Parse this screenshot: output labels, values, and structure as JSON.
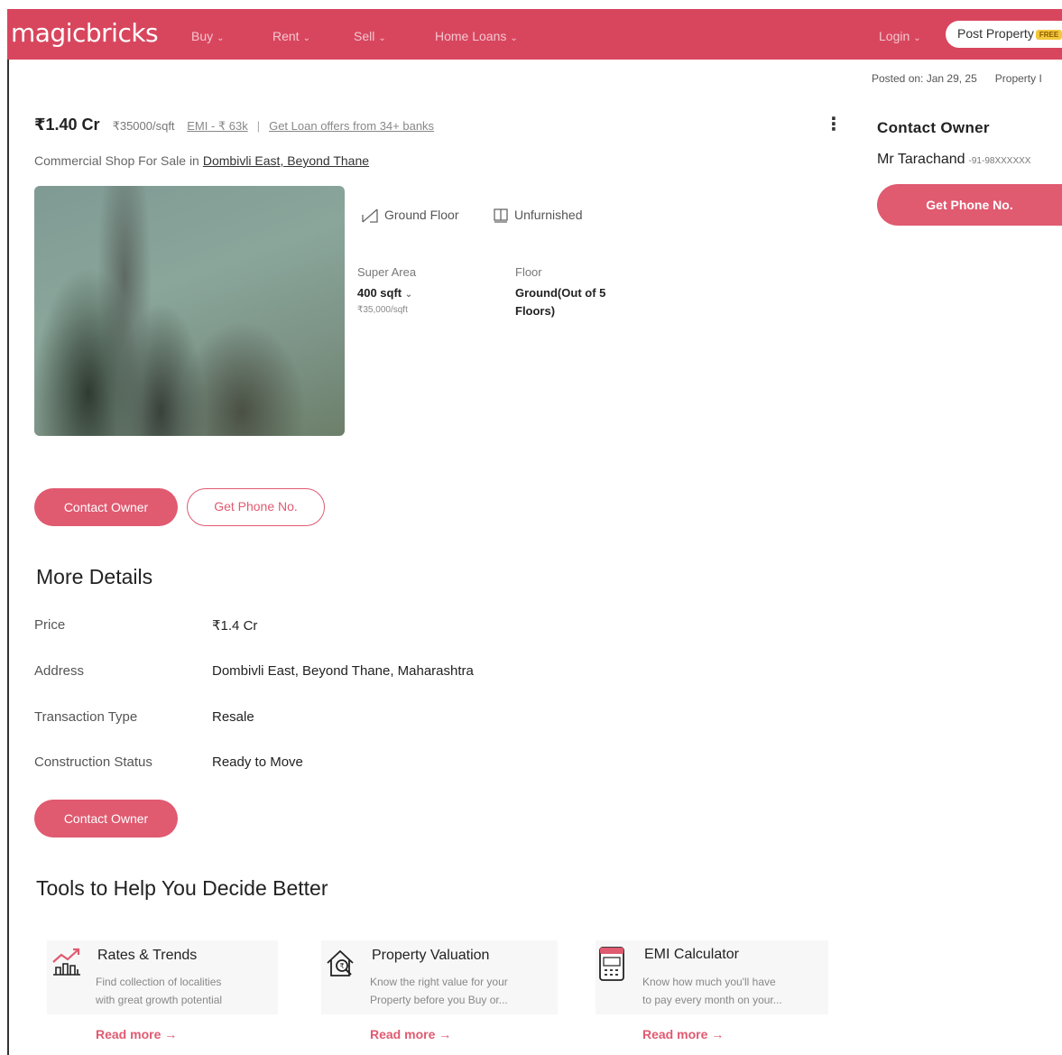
{
  "header": {
    "logo": "magicbricks",
    "nav": [
      {
        "label": "Buy"
      },
      {
        "label": "Rent"
      },
      {
        "label": "Sell"
      },
      {
        "label": "Home Loans"
      },
      {
        "label": "Login"
      }
    ],
    "post_property": "Post Property",
    "free_badge": "FREE",
    "brand_color": "#d8465e"
  },
  "meta": {
    "posted_on": "Posted on: Jan 29, 25",
    "property_id": "Property I"
  },
  "listing": {
    "price": "₹1.40 Cr",
    "price_per_sqft": "₹35000/sqft",
    "emi": "EMI - ₹ 63k",
    "loan_offers": "Get Loan offers from 34+ banks",
    "subtitle": "Commercial Shop For Sale in",
    "location": "Dombivli East, Beyond Thane",
    "chips": [
      {
        "icon": "floor-icon",
        "label": "Ground Floor"
      },
      {
        "icon": "furnishing-icon",
        "label": "Unfurnished"
      }
    ],
    "super_area_label": "Super Area",
    "super_area_value": "400 sqft",
    "super_area_rate": "₹35,000/sqft",
    "floor_label": "Floor",
    "floor_value_line1": "Ground(Out of 5",
    "floor_value_line2": "Floors)",
    "contact_owner": "Contact Owner",
    "get_phone": "Get Phone No."
  },
  "more_details": {
    "title": "More Details",
    "rows": [
      {
        "label": "Price",
        "value": "₹1.4 Cr"
      },
      {
        "label": "Address",
        "value": "Dombivli East, Beyond Thane, Maharashtra"
      },
      {
        "label": "Transaction Type",
        "value": "Resale"
      },
      {
        "label": "Construction Status",
        "value": "Ready to Move"
      }
    ],
    "contact_owner": "Contact Owner"
  },
  "sidebar": {
    "title": "Contact Owner",
    "owner_name": "Mr Tarachand",
    "owner_phone": "-91-98XXXXXX",
    "get_phone": "Get Phone No."
  },
  "tools": {
    "title": "Tools to Help You Decide Better",
    "items": [
      {
        "icon": "rates-trends-icon",
        "title": "Rates & Trends",
        "desc1": "Find collection of localities",
        "desc2": "with great growth potential",
        "link": "Read more"
      },
      {
        "icon": "property-valuation-icon",
        "title": "Property Valuation",
        "desc1": "Know the right value for your",
        "desc2": "Property before you Buy or...",
        "link": "Read more"
      },
      {
        "icon": "emi-calculator-icon",
        "title": "EMI Calculator",
        "desc1": "Know how much you'll have",
        "desc2": "to pay every month on your...",
        "link": "Read more"
      }
    ]
  }
}
